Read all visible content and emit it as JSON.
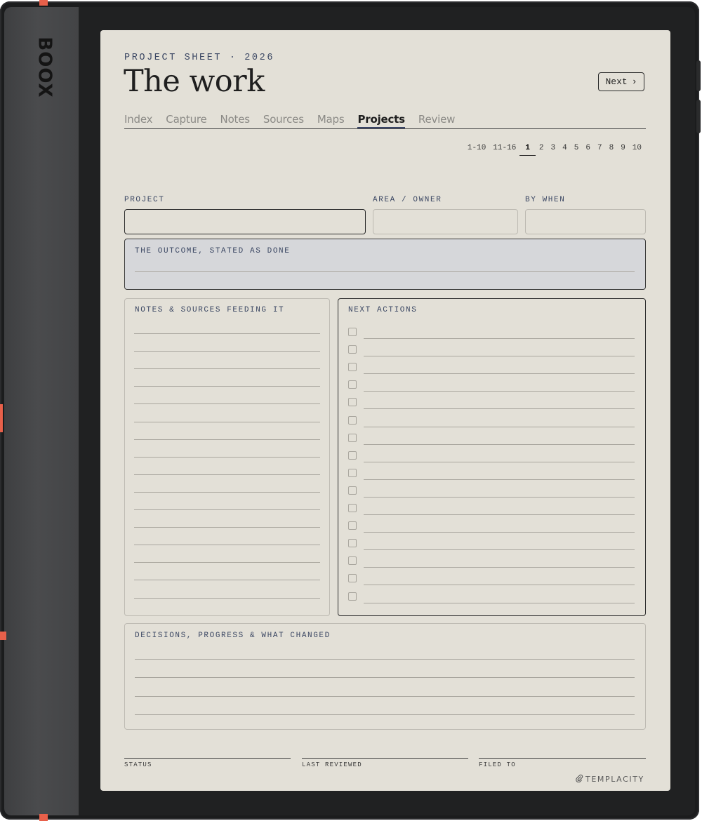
{
  "device": {
    "brand": "BOOX",
    "accent_color": "#e8604a"
  },
  "page": {
    "kicker": "PROJECT SHEET · 2026",
    "title": "The work",
    "next_button": {
      "label": "Next",
      "icon": "chevron-right-icon"
    },
    "tabs": [
      {
        "label": "Index",
        "active": false
      },
      {
        "label": "Capture",
        "active": false
      },
      {
        "label": "Notes",
        "active": false
      },
      {
        "label": "Sources",
        "active": false
      },
      {
        "label": "Maps",
        "active": false
      },
      {
        "label": "Projects",
        "active": true
      },
      {
        "label": "Review",
        "active": false
      }
    ],
    "pager": {
      "ranges": [
        "1-10",
        "11-16"
      ],
      "pages": [
        "1",
        "2",
        "3",
        "4",
        "5",
        "6",
        "7",
        "8",
        "9",
        "10"
      ],
      "current": "1"
    }
  },
  "form": {
    "project_label": "PROJECT",
    "area_owner_label": "AREA / OWNER",
    "by_when_label": "BY WHEN",
    "outcome_label": "THE OUTCOME, STATED AS DONE",
    "notes_label": "NOTES & SOURCES FEEDING IT",
    "next_actions_label": "NEXT ACTIONS",
    "decisions_label": "DECISIONS, PROGRESS & WHAT CHANGED"
  },
  "footer": {
    "status_label": "STATUS",
    "last_reviewed_label": "LAST REVIEWED",
    "filed_to_label": "FILED TO",
    "logo_text": "TEMPLACITY"
  }
}
